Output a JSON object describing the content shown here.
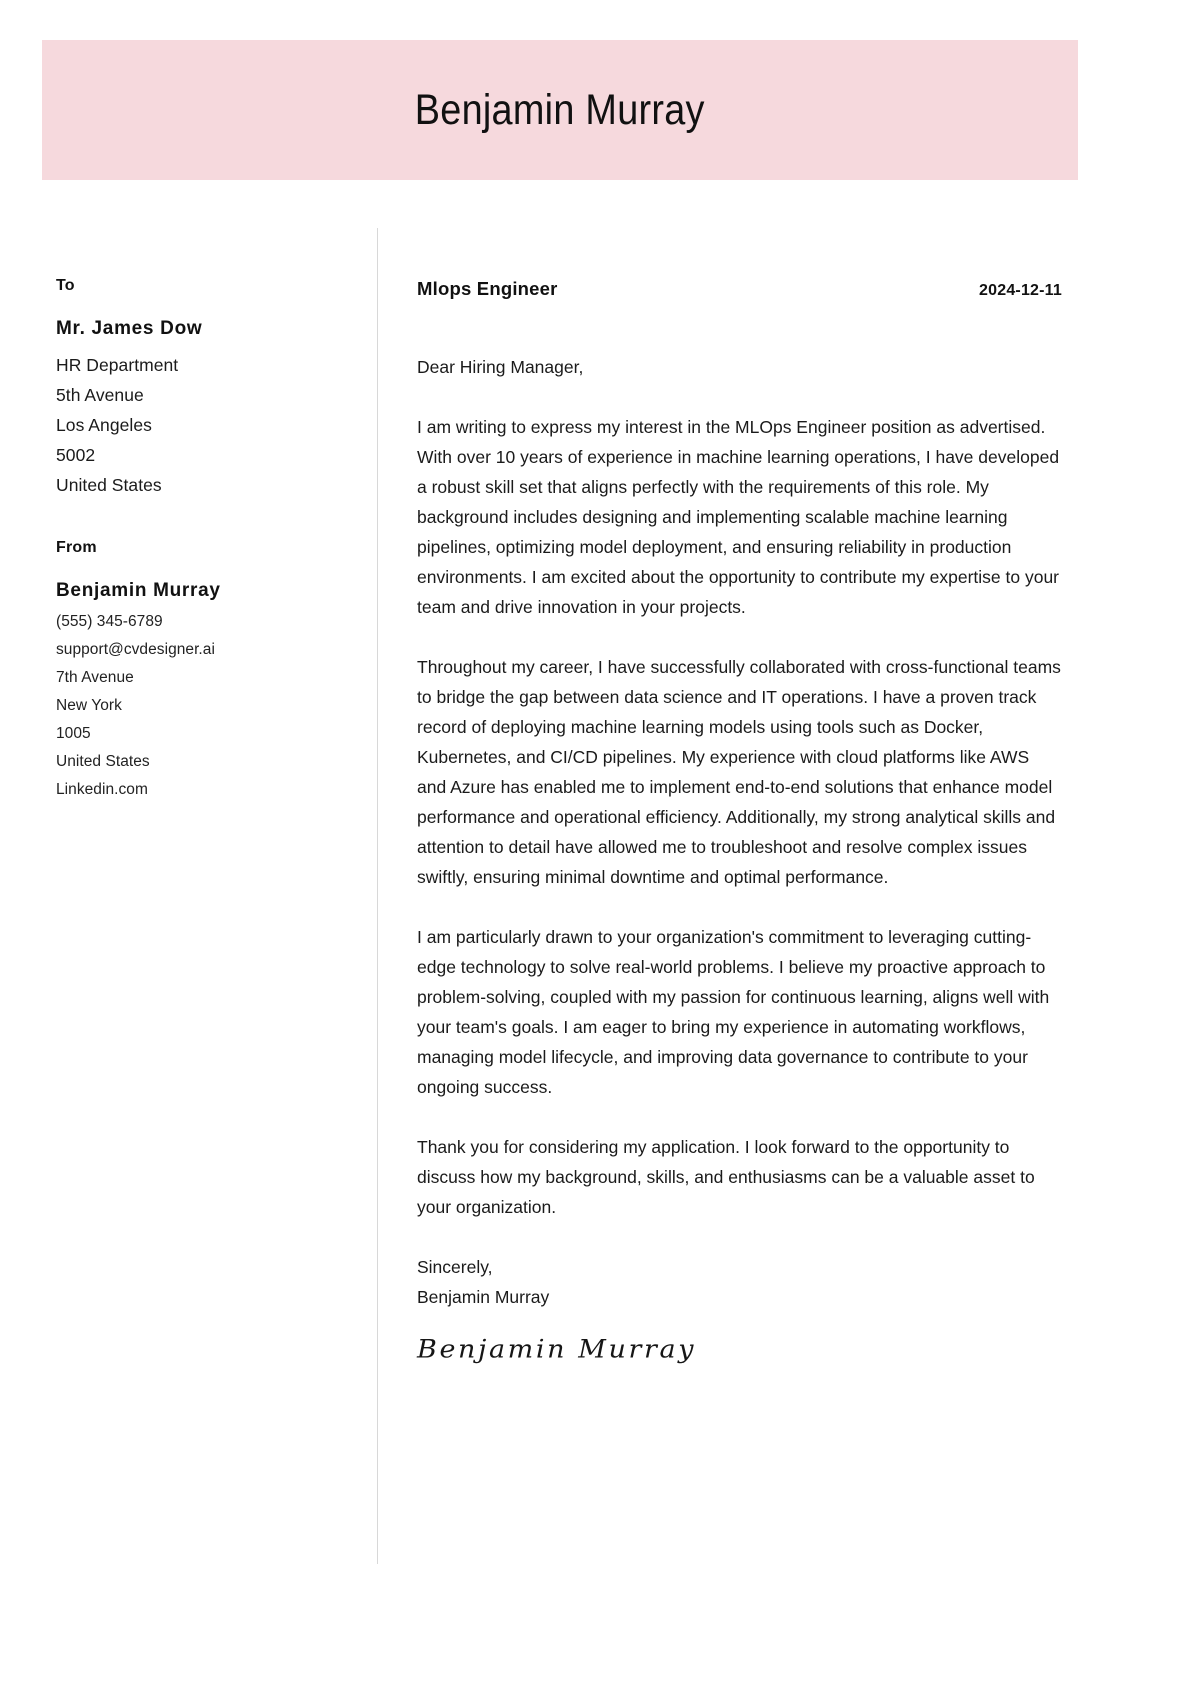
{
  "document": {
    "type": "cover-letter",
    "accent_color": "#f6d9dd",
    "text_color": "#1b1b1b"
  },
  "header": {
    "full_name": "Benjamin Murray"
  },
  "recipient": {
    "label": "To",
    "name": "Mr. James Dow",
    "lines": [
      "HR Department",
      "5th Avenue",
      "Los Angeles",
      "5002",
      "United States"
    ]
  },
  "sender": {
    "label": "From",
    "name": "Benjamin Murray",
    "lines": [
      "(555) 345-6789",
      "support@cvdesigner.ai",
      "7th Avenue",
      "New York",
      "1005",
      "United States",
      "Linkedin.com"
    ]
  },
  "letter": {
    "job_title": "Mlops Engineer",
    "date": "2024-12-11",
    "salutation": "Dear Hiring Manager,",
    "paragraphs": [
      "I am writing to express my interest in the MLOps Engineer position as advertised. With over 10 years of experience in machine learning operations, I have developed a robust skill set that aligns perfectly with the requirements of this role. My background includes designing and implementing scalable machine learning pipelines, optimizing model deployment, and ensuring reliability in production environments. I am excited about the opportunity to contribute my expertise to your team and drive innovation in your projects.",
      "Throughout my career, I have successfully collaborated with cross-functional teams to bridge the gap between data science and IT operations. I have a proven track record of deploying machine learning models using tools such as Docker, Kubernetes, and CI/CD pipelines. My experience with cloud platforms like AWS and Azure has enabled me to implement end-to-end solutions that enhance model performance and operational efficiency. Additionally, my strong analytical skills and attention to detail have allowed me to troubleshoot and resolve complex issues swiftly, ensuring minimal downtime and optimal performance.",
      "I am particularly drawn to your organization's commitment to leveraging cutting-edge technology to solve real-world problems. I believe my proactive approach to problem-solving, coupled with my passion for continuous learning, aligns well with your team's goals. I am eager to bring my experience in automating workflows, managing model lifecycle, and improving data governance to contribute to your ongoing success.",
      "Thank you for considering my application. I look forward to the opportunity to discuss how my background, skills, and enthusiasms can be a valuable asset to your organization."
    ],
    "closing": "Sincerely,",
    "closing_name": "Benjamin Murray",
    "signature": "Benjamin Murray"
  }
}
